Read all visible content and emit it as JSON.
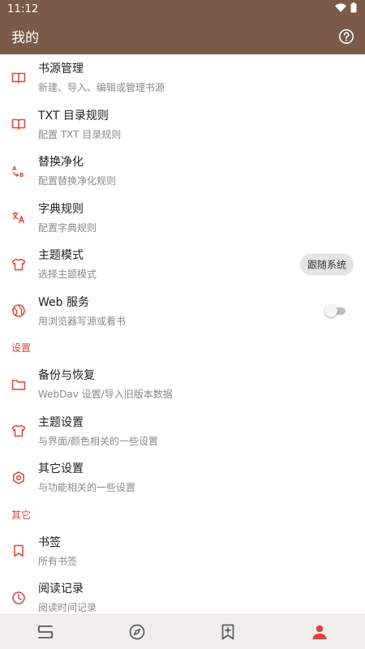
{
  "status": {
    "time": "11:12"
  },
  "appbar": {
    "title": "我的",
    "help_icon": "help-circle-icon"
  },
  "colors": {
    "accent": "#d9453a",
    "appbar": "#7a5a48",
    "bottom_nav": "#f1efee"
  },
  "items": [
    {
      "title": "书源管理",
      "subtitle": "新建、导入、编辑或管理书源",
      "icon": "book-open-icon"
    },
    {
      "title": "TXT 目录规则",
      "subtitle": "配置 TXT 目录规则",
      "icon": "book-open-icon"
    },
    {
      "title": "替换净化",
      "subtitle": "配置替换净化规则",
      "icon": "replace-ab-icon"
    },
    {
      "title": "字典规则",
      "subtitle": "配置字典规则",
      "icon": "translate-icon"
    },
    {
      "title": "主题模式",
      "subtitle": "选择主题模式",
      "icon": "tshirt-icon",
      "value": "跟随系统"
    },
    {
      "title": "Web 服务",
      "subtitle": "用浏览器写源或看书",
      "icon": "globe-icon",
      "toggle": false
    }
  ],
  "section_settings": {
    "label": "设置"
  },
  "settings_items": [
    {
      "title": "备份与恢复",
      "subtitle": "WebDav 设置/导入旧版本数据",
      "icon": "folder-icon"
    },
    {
      "title": "主题设置",
      "subtitle": "与界面/颜色相关的一些设置",
      "icon": "tshirt-icon"
    },
    {
      "title": "其它设置",
      "subtitle": "与功能相关的一些设置",
      "icon": "settings-gear-icon"
    }
  ],
  "section_other": {
    "label": "其它"
  },
  "other_items": [
    {
      "title": "书签",
      "subtitle": "所有书签",
      "icon": "bookmark-icon"
    },
    {
      "title": "阅读记录",
      "subtitle": "阅读时间记录",
      "icon": "clock-icon"
    }
  ],
  "bottom_nav": [
    {
      "name": "bookshelf",
      "icon": "bookshelf-icon",
      "active": false
    },
    {
      "name": "discover",
      "icon": "compass-icon",
      "active": false
    },
    {
      "name": "rss",
      "icon": "bookmark-plus-icon",
      "active": false
    },
    {
      "name": "my",
      "icon": "person-icon",
      "active": true
    }
  ]
}
